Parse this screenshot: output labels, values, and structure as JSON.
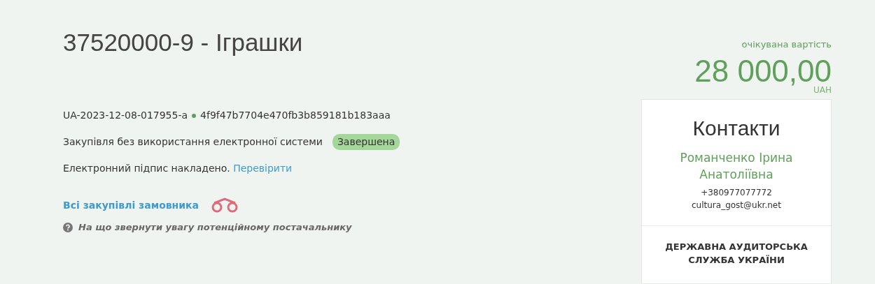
{
  "title": "37520000-9 - Іграшки",
  "tender": {
    "id": "UA-2023-12-08-017955-a",
    "hash": "4f9f47b7704e470fb3b859181b183aaa"
  },
  "procedure": {
    "label": "Закупівля без використання електронної системи",
    "status": {
      "label": "Завершена",
      "color": "#a5d69a"
    }
  },
  "signature": {
    "text": "Електронний підпис накладено.",
    "link": "Перевірити"
  },
  "customer_link": "Всі закупівлі замовника",
  "hint": "На що звернути увагу потенційному постачальнику",
  "value": {
    "label": "очікувана вартість",
    "amount": "28 000,00",
    "currency": "UAH"
  },
  "contacts": {
    "title": "Контакти",
    "name": "Романченко Ірина Анатоліївна",
    "phone": "+380977077772",
    "email": "cultura_gost@ukr.net",
    "organization": "ДЕРЖАВНА АУДИТОРСЬКА СЛУЖБА УКРАЇНИ"
  }
}
